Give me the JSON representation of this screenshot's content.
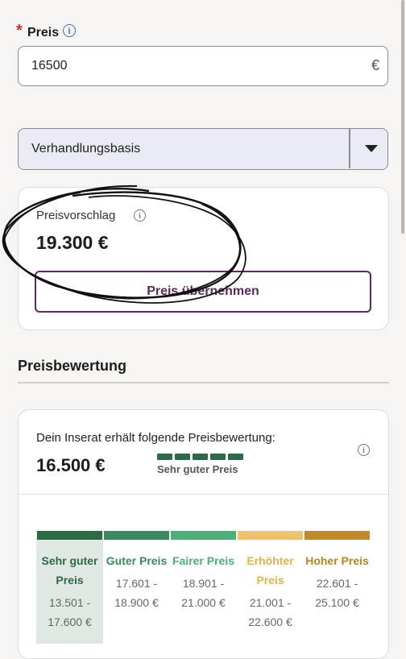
{
  "price_field": {
    "label": "Preis",
    "required_marker": "*",
    "info_icon": "info-icon",
    "value": "16500",
    "currency_suffix": "€"
  },
  "price_type_select": {
    "selected": "Verhandlungsbasis",
    "arrow_icon": "chevron-down-icon"
  },
  "price_suggestion": {
    "title": "Preisvorschlag",
    "info_icon": "info-icon",
    "value": "19.300 €",
    "button_label": "Preis übernehmen"
  },
  "price_rating_section": {
    "title": "Preisbewertung",
    "card_text": "Dein Inserat erhält folgende Preisbewertung:",
    "price": "16.500 €",
    "rating_label": "Sehr guter Preis",
    "rating_level": 5,
    "rating_max": 5,
    "info_icon": "info-icon",
    "scale": [
      {
        "name": "Sehr guter Preis",
        "range_from": "13.501 -",
        "range_to": "17.600 €",
        "color": "#2d6a46",
        "text_color": "#2d6a46",
        "active": true
      },
      {
        "name": "Guter Preis",
        "range_from": "17.601 -",
        "range_to": "18.900 €",
        "color": "#3a8a5d",
        "text_color": "#3a8a5d",
        "active": false
      },
      {
        "name": "Fairer Preis",
        "range_from": "18.901 -",
        "range_to": "21.000 €",
        "color": "#4fae78",
        "text_color": "#4fae78",
        "active": false
      },
      {
        "name": "Erhöhter Preis",
        "range_from": "21.001 -",
        "range_to": "22.600 €",
        "color": "#ecc56a",
        "text_color": "#e2b34a",
        "active": false
      },
      {
        "name": "Hoher Preis",
        "range_from": "22.601 -",
        "range_to": "25.100 €",
        "color": "#c08a2a",
        "text_color": "#b8861f",
        "active": false
      }
    ]
  }
}
